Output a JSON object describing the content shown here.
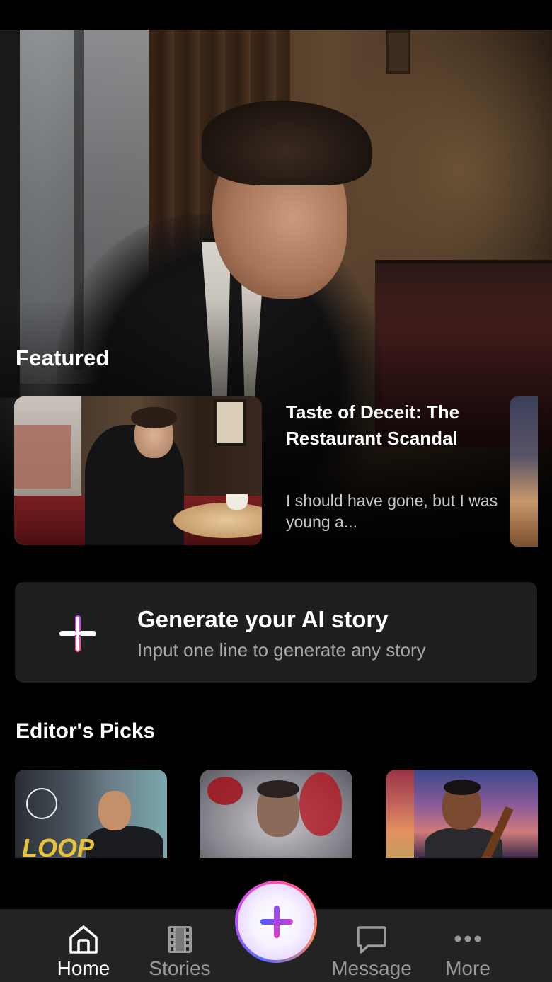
{
  "featured": {
    "section_title": "Featured",
    "card": {
      "title": "Taste of Deceit: The Restaurant Scandal",
      "description": "I should have gone, but I was young a..."
    }
  },
  "generate": {
    "icon": "plus-icon",
    "title": "Generate your AI story",
    "subtitle": "Input one line to generate any story"
  },
  "editors_picks": {
    "section_title": "Editor's Picks",
    "items": [
      {
        "cover_text": "LOOP"
      },
      {
        "cover_text": ""
      },
      {
        "cover_text": ""
      }
    ]
  },
  "nav": {
    "items": [
      {
        "label": "Home",
        "icon": "home-icon",
        "active": true
      },
      {
        "label": "Stories",
        "icon": "film-icon",
        "active": false
      },
      {
        "label": "Message",
        "icon": "chat-bubble-icon",
        "active": false
      },
      {
        "label": "More",
        "icon": "more-dots-icon",
        "active": false
      }
    ],
    "fab_icon": "plus-icon"
  },
  "colors": {
    "background": "#000000",
    "card": "#1f1f1f",
    "nav_bg": "#232323",
    "accent_start": "#5b5bff",
    "accent_end": "#e24be8"
  }
}
